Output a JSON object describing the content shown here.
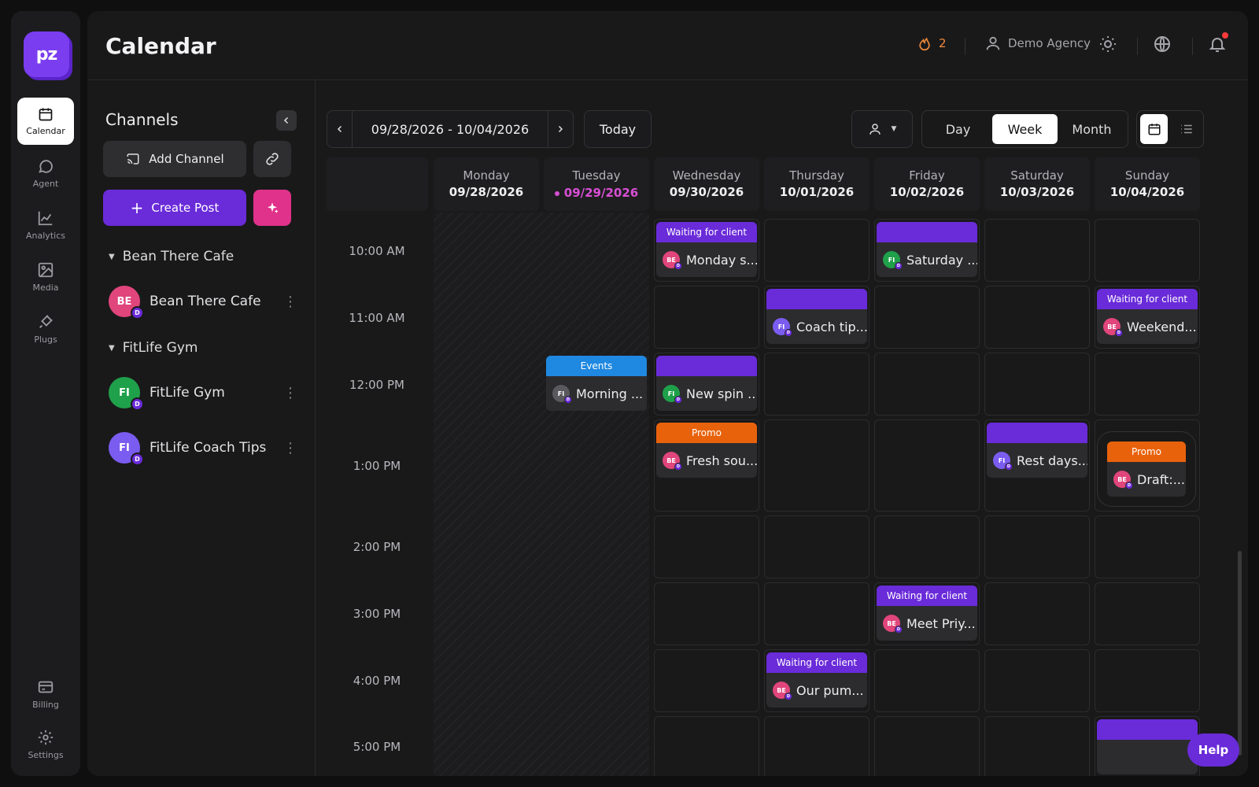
{
  "app": {
    "logo_text": "pz"
  },
  "rail": {
    "items": [
      {
        "label": "Calendar",
        "icon": "calendar-icon"
      },
      {
        "label": "Agent",
        "icon": "chat-icon"
      },
      {
        "label": "Analytics",
        "icon": "chart-icon"
      },
      {
        "label": "Media",
        "icon": "image-icon"
      },
      {
        "label": "Plugs",
        "icon": "plug-icon"
      },
      {
        "label": "Billing",
        "icon": "card-icon"
      },
      {
        "label": "Settings",
        "icon": "gear-icon"
      }
    ]
  },
  "header": {
    "title": "Calendar",
    "streak_count": "2",
    "user_name": "Demo Agency"
  },
  "sidebar": {
    "title": "Channels",
    "add_channel": "Add Channel",
    "create_post": "Create Post",
    "groups": [
      {
        "name": "Bean There Cafe",
        "channels": [
          {
            "initials": "BE",
            "name": "Bean There Cafe",
            "color": "#e0457b"
          }
        ]
      },
      {
        "name": "FitLife Gym",
        "channels": [
          {
            "initials": "FI",
            "name": "FitLife Gym",
            "color": "#1fa04a"
          },
          {
            "initials": "FI",
            "name": "FitLife Coach Tips",
            "color": "#7b5cf0"
          }
        ]
      }
    ],
    "badge": "D"
  },
  "calendar": {
    "range": "09/28/2026 - 10/04/2026",
    "today_label": "Today",
    "views": [
      "Day",
      "Week",
      "Month"
    ],
    "active_view": "Week",
    "days": [
      {
        "name": "Monday",
        "date": "09/28/2026"
      },
      {
        "name": "Tuesday",
        "date": "09/29/2026",
        "today": true
      },
      {
        "name": "Wednesday",
        "date": "09/30/2026"
      },
      {
        "name": "Thursday",
        "date": "10/01/2026"
      },
      {
        "name": "Friday",
        "date": "10/02/2026"
      },
      {
        "name": "Saturday",
        "date": "10/03/2026"
      },
      {
        "name": "Sunday",
        "date": "10/04/2026"
      }
    ],
    "times": [
      "10:00 AM",
      "11:00 AM",
      "12:00 PM",
      "1:00 PM",
      "2:00 PM",
      "3:00 PM",
      "4:00 PM",
      "5:00 PM"
    ],
    "events": [
      {
        "tag": "Waiting for client",
        "tag_color": "#6a2bd9",
        "text": "Monday s...",
        "initials": "BE",
        "avatar_color": "#e0457b"
      },
      {
        "tag": "",
        "tag_color": "#6a2bd9",
        "text": "Saturday ...",
        "initials": "FI",
        "avatar_color": "#1fa04a"
      },
      {
        "tag": "",
        "tag_color": "#6a2bd9",
        "text": "Coach tip...",
        "initials": "FI",
        "avatar_color": "#7b5cf0"
      },
      {
        "tag": "Waiting for client",
        "tag_color": "#6a2bd9",
        "text": "Weekend...",
        "initials": "BE",
        "avatar_color": "#e0457b"
      },
      {
        "tag": "Events",
        "tag_color": "#1f88e0",
        "text": "Morning ...",
        "initials": "FI",
        "avatar_color": "#5a5a5e"
      },
      {
        "tag": "",
        "tag_color": "#6a2bd9",
        "text": "New spin ...",
        "initials": "FI",
        "avatar_color": "#1fa04a"
      },
      {
        "tag": "Promo",
        "tag_color": "#e8620c",
        "text": "Fresh sou...",
        "initials": "BE",
        "avatar_color": "#e0457b"
      },
      {
        "tag": "",
        "tag_color": "#6a2bd9",
        "text": "Rest days...",
        "initials": "FI",
        "avatar_color": "#7b5cf0"
      },
      {
        "tag": "Promo",
        "tag_color": "#e8620c",
        "text": "Draft:...",
        "initials": "BE",
        "avatar_color": "#e0457b"
      },
      {
        "tag": "Waiting for client",
        "tag_color": "#6a2bd9",
        "text": "Meet Priy...",
        "initials": "BE",
        "avatar_color": "#e0457b"
      },
      {
        "tag": "Waiting for client",
        "tag_color": "#6a2bd9",
        "text": "Our pum...",
        "initials": "BE",
        "avatar_color": "#e0457b"
      },
      {
        "tag": "",
        "tag_color": "#6a2bd9",
        "text": "",
        "initials": "",
        "avatar_color": "#1fa04a"
      }
    ]
  },
  "help": {
    "label": "Help"
  }
}
